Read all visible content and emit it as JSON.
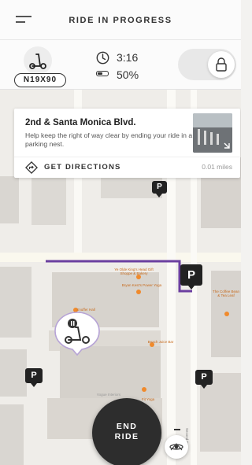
{
  "header": {
    "title": "RIDE IN PROGRESS",
    "menu_icon": "menu-icon"
  },
  "status": {
    "vehicle_id": "N19X90",
    "ride_time": "3:16",
    "battery": "50%",
    "battery_level": 0.5,
    "lock_icon": "lock-icon"
  },
  "card": {
    "address": "2nd & Santa Monica Blvd.",
    "description": "Help keep the right of way clear by ending your ride in a parking nest.",
    "directions_label": "GET DIRECTIONS",
    "distance": "0.01 miles"
  },
  "map": {
    "parking_label": "P",
    "street_label": "Second St",
    "pois": [
      "Ye Olde King's Head Gift Shoppe & Bakery",
      "Bryan Kest's Power Yoga",
      "The Coffee Bean & Tea Leaf",
      "Snuffer Hall",
      "Beach Juice Bar",
      "Vogue Interiors",
      "Fit Yoga"
    ]
  },
  "end_ride": {
    "line1": "END",
    "line2": "RIDE"
  },
  "colors": {
    "route": "#6b3fa0",
    "poi": "#f08a2c",
    "accent_dark": "#2d2d2d"
  }
}
